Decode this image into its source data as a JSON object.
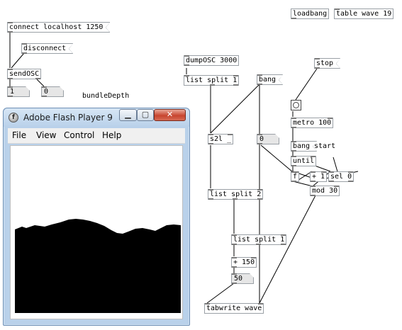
{
  "objects": {
    "connect": "connect localhost 1250",
    "disconnect": "disconnect",
    "sendosc": "sendOSC",
    "num1": "1",
    "num0": "0",
    "bundle_depth": "bundleDepth",
    "loadbang": "loadbang",
    "table_wave": "table wave 19",
    "dumposc": "dumpOSC 3000",
    "list_split_1a": "list split 1",
    "bang_msg": "bang",
    "stop": "stop",
    "s2l": "s2l _",
    "num_mid": "0",
    "metro": "metro 100",
    "bang2": "bang",
    "start": "start",
    "until": "until",
    "f": "f",
    "plus1": "+ 1",
    "sel0": "sel 0",
    "mod30": "mod 30",
    "list_split_2": "list split 2",
    "list_split_1b": "list split 1",
    "plus150": "+ 150",
    "num50": "50",
    "tabwrite": "tabwrite wave"
  },
  "flash_window": {
    "title": "Adobe Flash Player 9",
    "icon_letter": "f",
    "minimize": "▁",
    "maximize": "▢",
    "close": "✕",
    "menu": [
      "File",
      "View",
      "Control",
      "Help"
    ],
    "waveform_fill": "#000000"
  }
}
